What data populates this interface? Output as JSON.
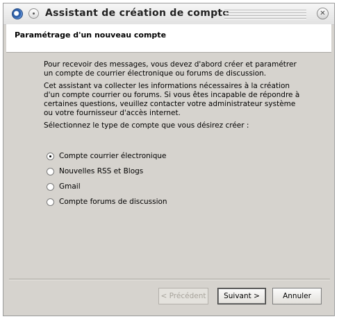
{
  "window": {
    "title": "Assistant de création de compte",
    "close_glyph": "✕"
  },
  "header": {
    "title": "Paramétrage d'un nouveau compte"
  },
  "content": {
    "paragraph1": "Pour recevoir des messages, vous devez d'abord créer et paramétrer un compte de courrier électronique ou forums de discussion.",
    "paragraph2": "Cet assistant va collecter les informations nécessaires à la création d'un compte courrier ou forums. Si vous êtes incapable de répondre à certaines questions, veuillez contacter votre administrateur système ou votre fournisseur d'accès internet.",
    "prompt": "Sélectionnez le type de compte que vous désirez créer :"
  },
  "account_types": [
    {
      "label": "Compte courrier électronique",
      "checked": true
    },
    {
      "label": "Nouvelles RSS et Blogs",
      "checked": false
    },
    {
      "label": "Gmail",
      "checked": false
    },
    {
      "label": "Compte forums de discussion",
      "checked": false
    }
  ],
  "buttons": {
    "previous": "< Précédent",
    "next": "Suivant >",
    "cancel": "Annuler"
  },
  "icons": {
    "app": "thunderbird-icon",
    "menu": "window-menu-icon",
    "close": "close-icon"
  }
}
